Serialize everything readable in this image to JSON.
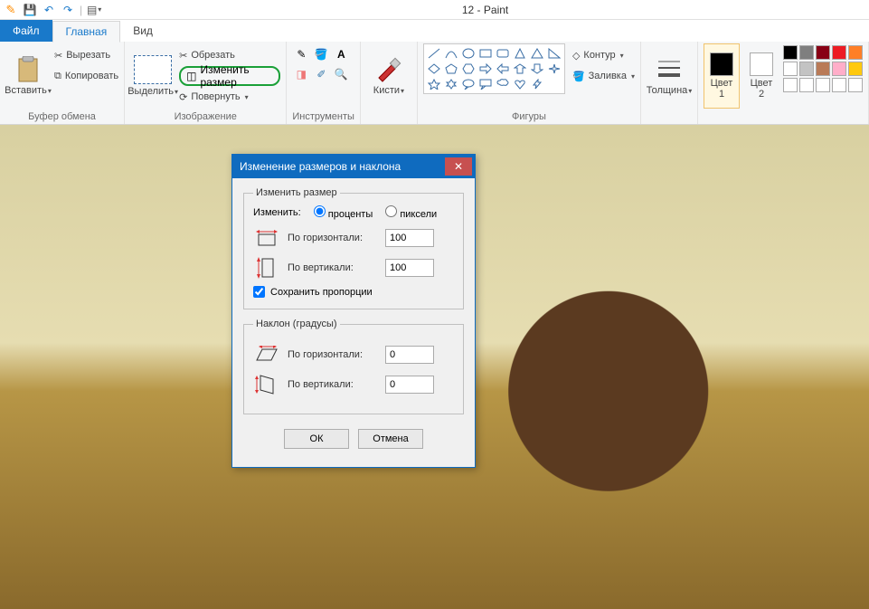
{
  "titlebar": {
    "title": "12 - Paint"
  },
  "qat_icons": [
    "save-icon",
    "undo-icon",
    "redo-icon"
  ],
  "tabs": {
    "file": "Файл",
    "home": "Главная",
    "view": "Вид"
  },
  "ribbon": {
    "clipboard": {
      "paste": "Вставить",
      "cut": "Вырезать",
      "copy": "Копировать",
      "label": "Буфер обмена"
    },
    "image": {
      "select": "Выделить",
      "crop": "Обрезать",
      "resize": "Изменить размер",
      "rotate": "Повернуть",
      "label": "Изображение"
    },
    "tools": {
      "label": "Инструменты"
    },
    "brushes": {
      "label": "Кисти"
    },
    "shapes": {
      "outline": "Контур",
      "fill": "Заливка",
      "label": "Фигуры"
    },
    "size": {
      "label": "Толщина"
    },
    "colors": {
      "color1": "Цвет\n1",
      "color2": "Цвет\n2"
    }
  },
  "palette": {
    "row1": [
      "#000000",
      "#7f7f7f",
      "#880015",
      "#ed1c24",
      "#ff7f27"
    ],
    "row2": [
      "#ffffff",
      "#c3c3c3",
      "#b97a57",
      "#ffaec9",
      "#ffc90e"
    ],
    "row3": [
      "#ffffff",
      "#ffffff",
      "#ffffff",
      "#ffffff",
      "#ffffff"
    ]
  },
  "dialog": {
    "title": "Изменение размеров и наклона",
    "resize": {
      "legend": "Изменить размер",
      "change_label": "Изменить:",
      "percent": "проценты",
      "pixels": "пиксели",
      "horiz": "По горизонтали:",
      "vert": "По вертикали:",
      "horiz_val": "100",
      "vert_val": "100",
      "keep_aspect": "Сохранить пропорции"
    },
    "skew": {
      "legend": "Наклон (градусы)",
      "horiz": "По горизонтали:",
      "vert": "По вертикали:",
      "horiz_val": "0",
      "vert_val": "0"
    },
    "ok": "ОК",
    "cancel": "Отмена"
  }
}
